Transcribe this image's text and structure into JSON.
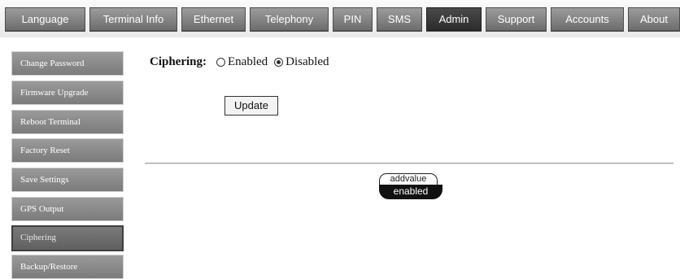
{
  "topnav": {
    "tabs": [
      {
        "label": "Language"
      },
      {
        "label": "Terminal Info"
      },
      {
        "label": "Ethernet"
      },
      {
        "label": "Telephony"
      },
      {
        "label": "PIN"
      },
      {
        "label": "SMS"
      },
      {
        "label": "Admin",
        "active": true
      },
      {
        "label": "Support"
      },
      {
        "label": "Accounts"
      },
      {
        "label": "About"
      }
    ]
  },
  "sidebar": {
    "items": [
      {
        "label": "Change Password"
      },
      {
        "label": "Firmware Upgrade"
      },
      {
        "label": "Reboot Terminal"
      },
      {
        "label": "Factory Reset"
      },
      {
        "label": "Save Settings"
      },
      {
        "label": "GPS Output"
      },
      {
        "label": "Ciphering",
        "active": true
      },
      {
        "label": "Backup/Restore"
      }
    ]
  },
  "main": {
    "ciphering_label": "Ciphering:",
    "option_enabled": "Enabled",
    "option_disabled": "Disabled",
    "selected": "Disabled",
    "update_label": "Update"
  },
  "logo": {
    "line1": "addvalue",
    "line2": "enabled"
  },
  "colors": {
    "tab_bg": "#808080",
    "tab_active_bg": "#333333",
    "sidebar_bg": "#8a8a8a"
  }
}
